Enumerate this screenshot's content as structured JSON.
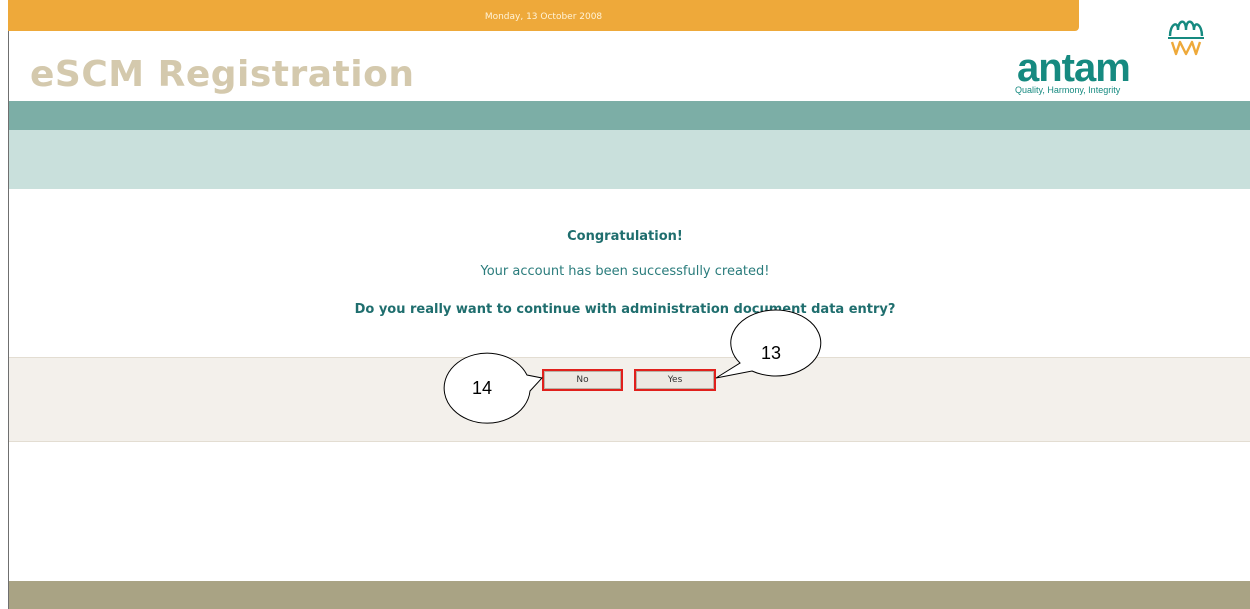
{
  "header": {
    "date": "Monday, 13 October 2008",
    "app_title": "eSCM Registration"
  },
  "logo": {
    "brand": "antam",
    "tagline": "Quality, Harmony, Integrity"
  },
  "message": {
    "congratulation": "Congratulation!",
    "success": "Your account has been successfully created!",
    "question": "Do you really want to continue with administration document data entry?"
  },
  "buttons": {
    "no_label": "No",
    "yes_label": "Yes"
  },
  "annotations": {
    "callout_no": "14",
    "callout_yes": "13"
  },
  "colors": {
    "date_bar": "#eea93a",
    "teal_band": "#7caea6",
    "light_band": "#c9e0dc",
    "brand_teal": "#168a80",
    "highlight_red": "#e0201c",
    "footer": "#a9a384"
  }
}
